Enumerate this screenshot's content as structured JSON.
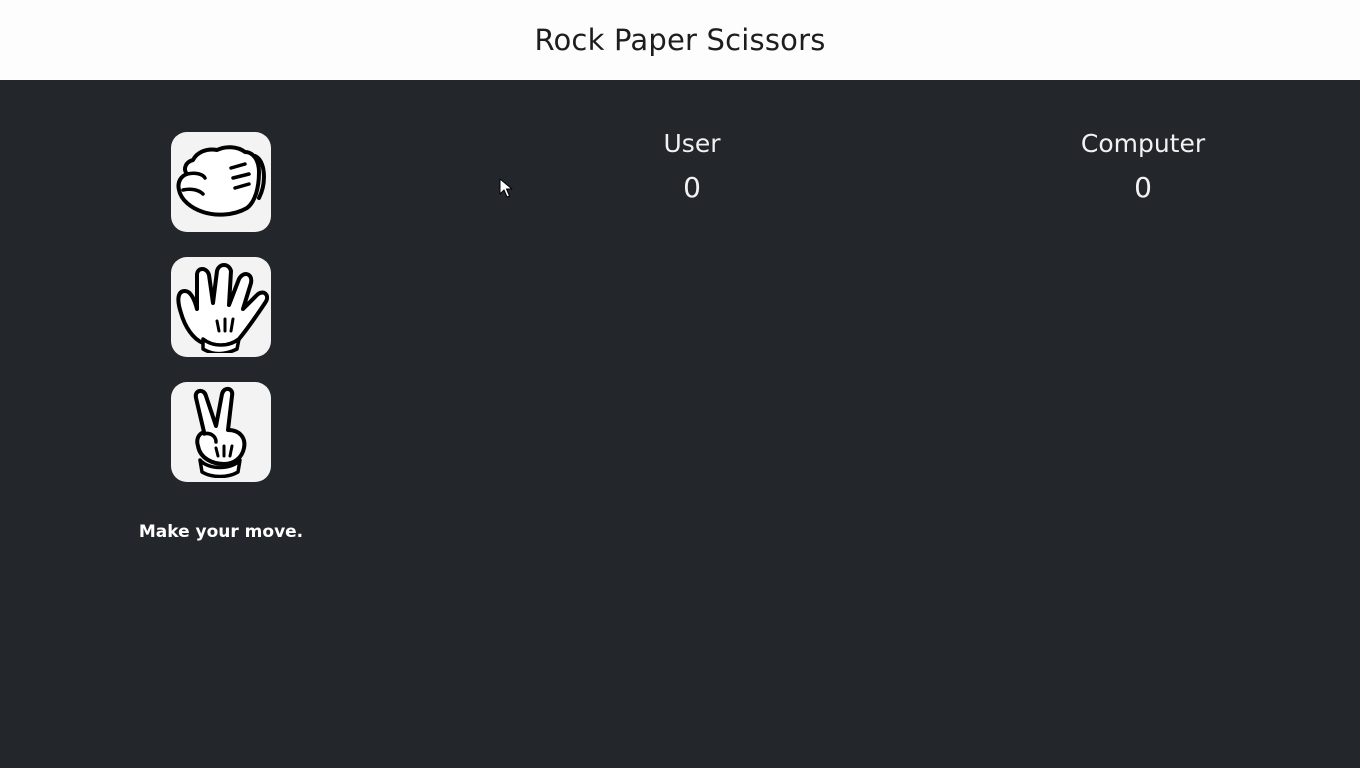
{
  "header": {
    "title": "Rock Paper Scissors"
  },
  "moves": [
    {
      "id": "rock",
      "icon": "rock-hand-icon"
    },
    {
      "id": "paper",
      "icon": "paper-hand-icon"
    },
    {
      "id": "scissors",
      "icon": "scissors-hand-icon"
    }
  ],
  "status": {
    "message": "Make your move."
  },
  "scoreboard": {
    "user": {
      "label": "User",
      "score": "0"
    },
    "computer": {
      "label": "Computer",
      "score": "0"
    }
  },
  "colors": {
    "background": "#23262b",
    "header_background": "#fdfdfd",
    "tile_background": "#f3f3f3",
    "text_light": "#f2f2f2"
  }
}
